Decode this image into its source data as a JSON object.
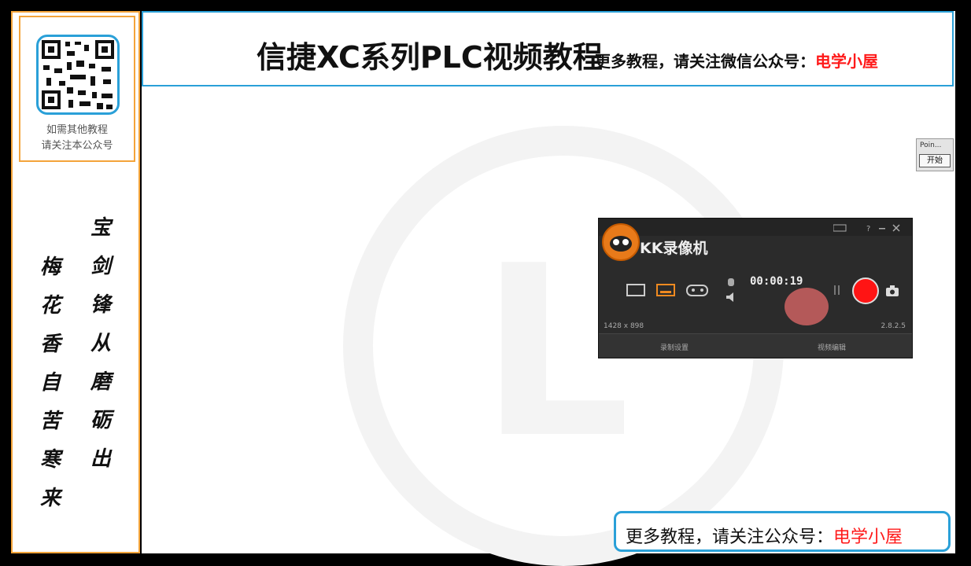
{
  "sidebar": {
    "qr_caption_1": "如需其他教程",
    "qr_caption_2": "请关注本公众号",
    "poem_right": [
      "宝",
      "剑",
      "锋",
      "从",
      "磨",
      "砺",
      "出"
    ],
    "poem_left": [
      "梅",
      "花",
      "香",
      "自",
      "苦",
      "寒",
      "来"
    ]
  },
  "header": {
    "title": "信捷XC系列PLC视频教程",
    "subtitle_prefix": "更多教程，请关注微信公众号：",
    "subtitle_highlight": "电学小屋"
  },
  "point_widget": {
    "title": "Poin...",
    "start_button": "开始"
  },
  "kk_recorder": {
    "app_name": "KK录像机",
    "elapsed_time": "00:00:19",
    "resolution_label": "1428 x 898",
    "version_label": "2.8.2.5",
    "bottom_left": "录制设置",
    "bottom_right": "视频编辑"
  },
  "footer": {
    "prefix": "更多教程，请关注公众号：",
    "highlight": "电学小屋"
  },
  "colors": {
    "accent_blue": "#2aa0d8",
    "accent_orange": "#f4a43a",
    "highlight_red": "#ff1a1a"
  }
}
